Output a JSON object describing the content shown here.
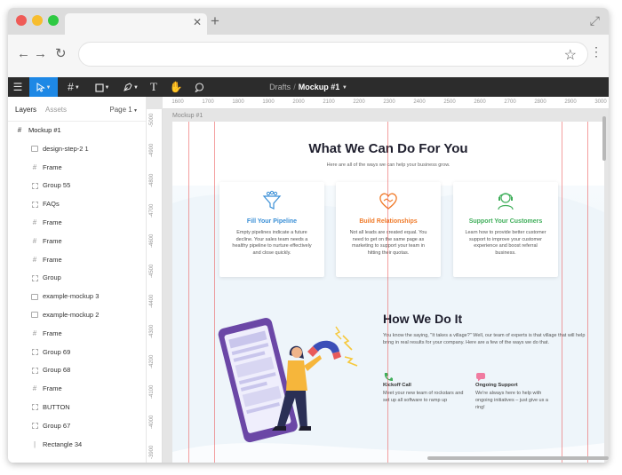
{
  "toolbar": {
    "breadcrumb_parent": "Drafts",
    "breadcrumb_separator": "/",
    "file_name": "Mockup #1",
    "text_tool": "T"
  },
  "left_panel": {
    "tabs": [
      "Layers",
      "Assets"
    ],
    "page_selector": "Page 1",
    "layers": [
      {
        "name": "Mockup #1",
        "icon": "frame-icon",
        "level": 0
      },
      {
        "name": "design-step-2 1",
        "icon": "image-icon",
        "level": 1
      },
      {
        "name": "Frame",
        "icon": "frame-icon",
        "level": 1
      },
      {
        "name": "Group 55",
        "icon": "group-icon",
        "level": 1
      },
      {
        "name": "FAQs",
        "icon": "group-icon",
        "level": 1
      },
      {
        "name": "Frame",
        "icon": "frame-icon",
        "level": 1
      },
      {
        "name": "Frame",
        "icon": "frame-icon",
        "level": 1
      },
      {
        "name": "Frame",
        "icon": "frame-icon",
        "level": 1
      },
      {
        "name": "Group",
        "icon": "group-icon",
        "level": 1
      },
      {
        "name": "example-mockup 3",
        "icon": "image-icon",
        "level": 1
      },
      {
        "name": "example-mockup 2",
        "icon": "image-icon",
        "level": 1
      },
      {
        "name": "Frame",
        "icon": "frame-icon",
        "level": 1
      },
      {
        "name": "Group 69",
        "icon": "group-icon",
        "level": 1
      },
      {
        "name": "Group 68",
        "icon": "group-icon",
        "level": 1
      },
      {
        "name": "Frame",
        "icon": "frame-icon",
        "level": 1
      },
      {
        "name": "BUTTON",
        "icon": "group-icon",
        "level": 1
      },
      {
        "name": "Group 67",
        "icon": "group-icon",
        "level": 1
      },
      {
        "name": "Rectangle 34",
        "icon": "rectangle-icon",
        "level": 1
      }
    ]
  },
  "rulers": {
    "horizontal": [
      "1600",
      "1700",
      "1800",
      "1900",
      "2000",
      "2100",
      "2200",
      "2300",
      "2400",
      "2500",
      "2600",
      "2700",
      "2800",
      "2900",
      "3000"
    ],
    "vertical": [
      "-5000",
      "-4900",
      "-4800",
      "-4700",
      "-4600",
      "-4500",
      "-4400",
      "-4300",
      "-4200",
      "-4100",
      "-4000",
      "-3900"
    ]
  },
  "canvas": {
    "frame_label": "Mockup #1",
    "section1": {
      "title": "What We Can Do For You",
      "subtitle": "Here are all of the ways we can help your business grow.",
      "cards": [
        {
          "title": "Fill Your Pipeline",
          "color": "#3a8fd6",
          "text": "Empty pipelines indicate a future decline. Your sales team needs a healthy pipeline to nurture effectively and close quickly."
        },
        {
          "title": "Build Relationships",
          "color": "#f07b2a",
          "text": "Not all leads are created equal. You need to get on the same page as marketing to support your team in hitting their quotas."
        },
        {
          "title": "Support Your Customers",
          "color": "#3fae5a",
          "text": "Learn how to provide better customer support to improve your customer experience and boost referral business."
        }
      ]
    },
    "section2": {
      "title": "How We Do It",
      "text": "You know the saying, \"It takes a village?\" Well, our team of experts is that village that will help bring in real results for your company. Here are a few of the ways we do that.",
      "features": [
        {
          "title": "Kickoff Call",
          "text": "Meet your new team of rockstars and set up all software to ramp up"
        },
        {
          "title": "Ongoing Support",
          "text": "We're always here to help with ongoing initiatives – just give us a ring!"
        }
      ]
    }
  },
  "colors": {
    "accent": "#1e88e5",
    "grid": "#eb5050"
  }
}
